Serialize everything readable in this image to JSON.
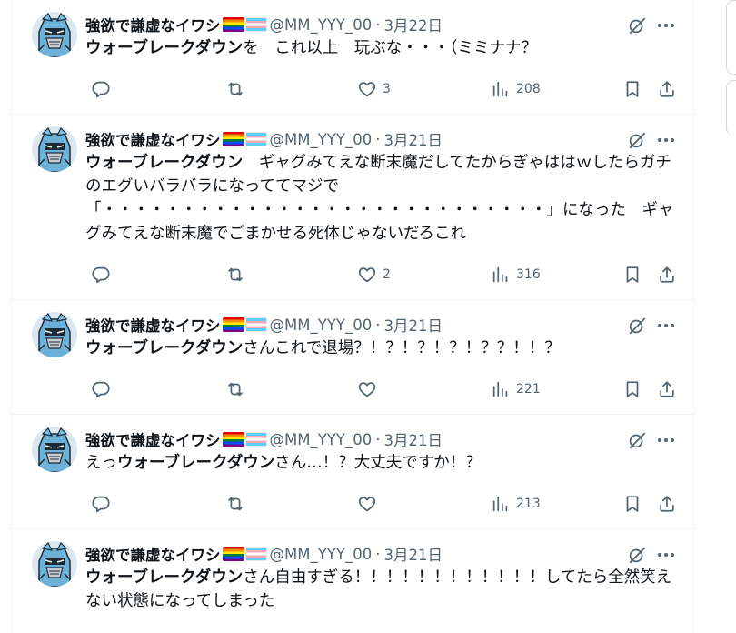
{
  "author": {
    "name": "強欲で謙虚なイワシ",
    "handle": "@MM_YYY_00",
    "flags": [
      "rainbow-flag",
      "transgender-flag"
    ]
  },
  "icons": {
    "reply": "reply-icon",
    "retweet": "retweet-icon",
    "like": "heart-icon",
    "views": "analytics-icon",
    "bookmark": "bookmark-icon",
    "share": "share-icon",
    "grok": "grok-icon",
    "more": "more-icon"
  },
  "tweets": [
    {
      "date": "3月22日",
      "mention": "ウォーブレークダウン",
      "text": "を　これ以上　玩ぶな・・・（ミミナナ？",
      "likes": "3",
      "views": "208"
    },
    {
      "date": "3月21日",
      "mention": "ウォーブレークダウン",
      "text": "　ギャグみてえな断末魔だしてたからぎゃははｗしたらガチのエグいバラバラになっててマジで「・・・・・・・・・・・・・・・・・・・・・・・・・・・・」になった　ギャグみてえな断末魔でごまかせる死体じゃないだろこれ",
      "likes": "2",
      "views": "316"
    },
    {
      "date": "3月21日",
      "mention": "ウォーブレークダウン",
      "text": "さんこれで退場？！？！？！？！？？！！？",
      "likes": "",
      "views": "221"
    },
    {
      "date": "3月21日",
      "prefix": "えっ",
      "mention": "ウォーブレークダウン",
      "text": "さん…！？大丈夫ですか！？",
      "likes": "",
      "views": "213"
    },
    {
      "date": "3月21日",
      "mention": "ウォーブレークダウン",
      "text": "さん自由すぎる！！！！！！！！！！！！してたら全然笑えない状態になってしまった",
      "likes": "",
      "views": ""
    }
  ]
}
